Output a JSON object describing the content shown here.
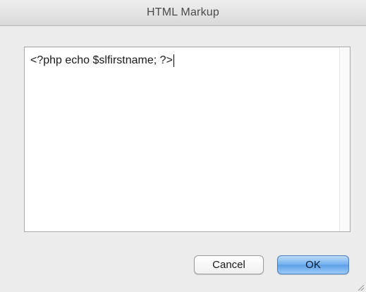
{
  "window": {
    "title": "HTML Markup"
  },
  "editor": {
    "content": "<?php echo $slfirstname; ?>"
  },
  "buttons": {
    "cancel_label": "Cancel",
    "ok_label": "OK"
  },
  "colors": {
    "ok_accent": "#5d9fe6",
    "background": "#ececec"
  },
  "icons": {
    "resize": "resize-grip-icon"
  }
}
